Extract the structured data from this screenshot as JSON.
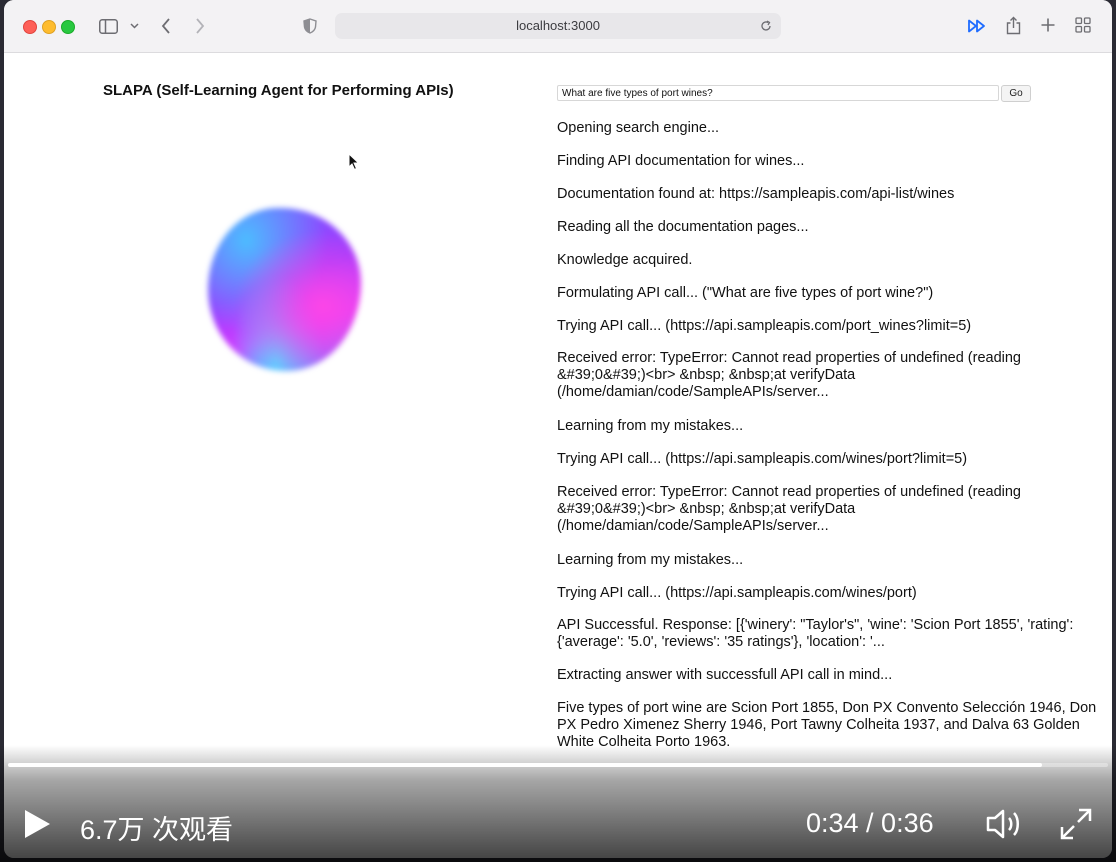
{
  "browser": {
    "url": "localhost:3000"
  },
  "app": {
    "title": "SLAPA (Self-Learning Agent for Performing APIs)",
    "query_value": "What are five types of port wines?",
    "go_label": "Go"
  },
  "log": [
    "Opening search engine...",
    "Finding API documentation for wines...",
    "Documentation found at: https://sampleapis.com/api-list/wines",
    "Reading all the documentation pages...",
    "Knowledge acquired.",
    "Formulating API call... (\"What are five types of port wine?\")",
    "Trying API call... (https://api.sampleapis.com/port_wines?limit=5)",
    "Received error: TypeError: Cannot read properties of undefined (reading &#39;0&#39;)<br> &nbsp; &nbsp;at verifyData (/home/damian/code/SampleAPIs/server...",
    "Learning from my mistakes...",
    "Trying API call... (https://api.sampleapis.com/wines/port?limit=5)",
    "Received error: TypeError: Cannot read properties of undefined (reading &#39;0&#39;)<br> &nbsp; &nbsp;at verifyData (/home/damian/code/SampleAPIs/server...",
    "Learning from my mistakes...",
    "Trying API call... (https://api.sampleapis.com/wines/port)",
    "API Successful. Response: [{'winery': \"Taylor's\", 'wine': 'Scion Port 1855', 'rating': {'average': '5.0', 'reviews': '35 ratings'}, 'location': '...",
    "Extracting answer with successfull API call in mind...",
    "Five types of port wine are Scion Port 1855, Don PX Convento Selección 1946, Don PX Pedro Ximenez Sherry 1946, Port Tawny Colheita 1937, and Dalva 63 Golden White Colheita Porto 1963."
  ],
  "video": {
    "views": "6.7万 次观看",
    "time": "0:34 / 0:36",
    "progress": 0.94
  },
  "colors": {
    "close": "#fe5f57",
    "minimize": "#febc2e",
    "zoom": "#28c840",
    "accent": "#1e6cff"
  },
  "icons": {
    "sidebar": "sidebar-icon",
    "back": "chevron-left-icon",
    "forward": "chevron-right-icon",
    "shield": "privacy-shield-icon",
    "reload": "reload-icon",
    "share": "share-icon",
    "new_tab": "plus-icon",
    "tabs": "tab-overview-icon",
    "play": "play-icon",
    "volume": "volume-icon",
    "fullscreen": "fullscreen-icon"
  }
}
